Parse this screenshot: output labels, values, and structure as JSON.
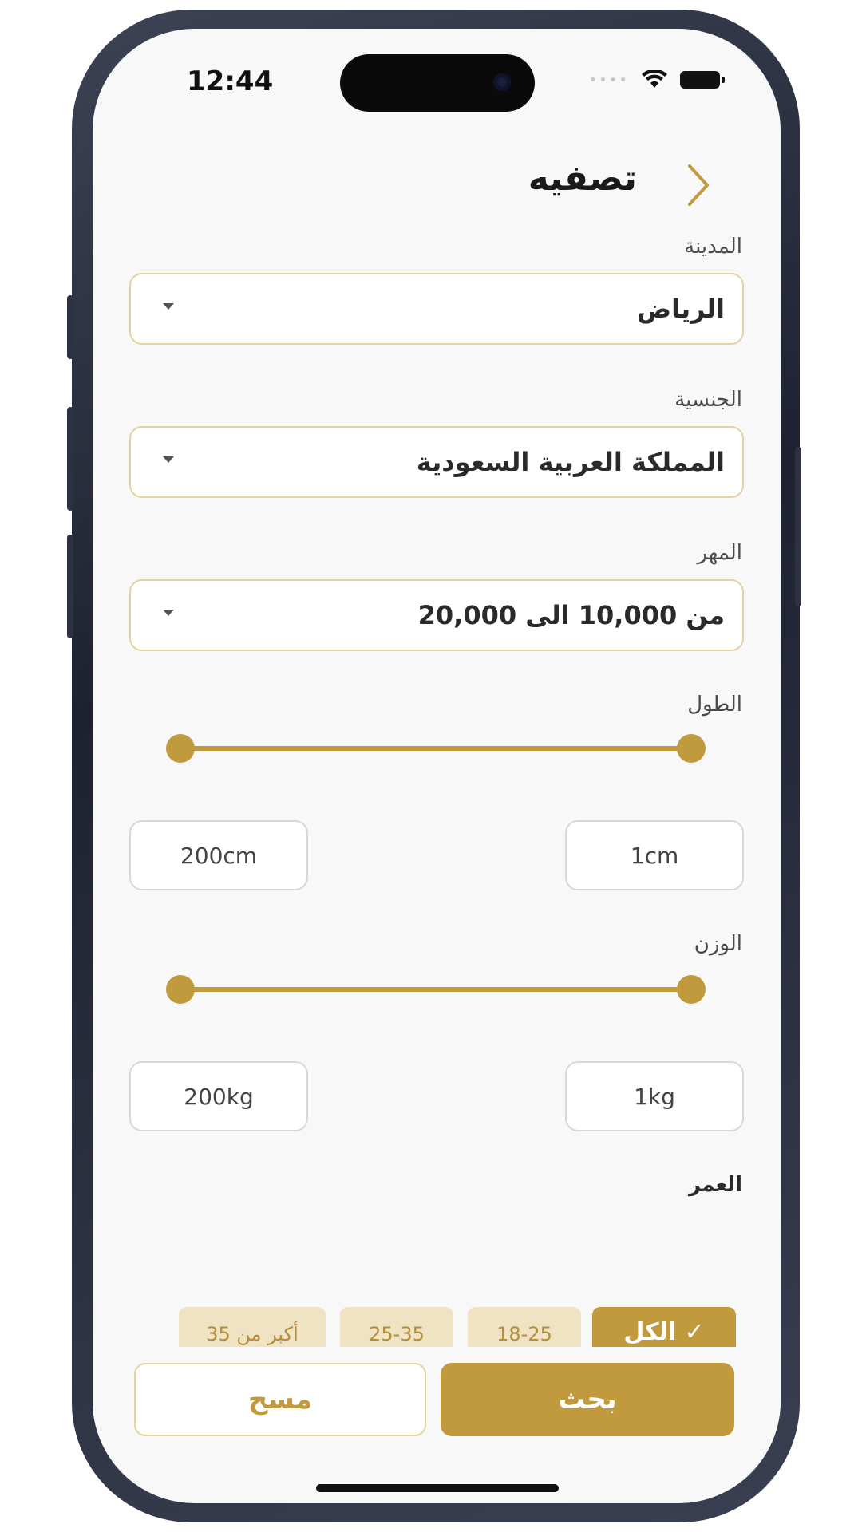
{
  "status": {
    "time": "12:44"
  },
  "header": {
    "title": "تصفيه"
  },
  "fields": {
    "city": {
      "label": "المدينة",
      "value": "الرياض"
    },
    "nationality": {
      "label": "الجنسية",
      "value": "المملكة العربية السعودية"
    },
    "dowry": {
      "label": "المهر",
      "value": "من 10,000 الى 20,000"
    }
  },
  "height": {
    "label": "الطول",
    "min": "1cm",
    "max": "200cm",
    "range_fraction": [
      0,
      1
    ]
  },
  "weight": {
    "label": "الوزن",
    "min": "1kg",
    "max": "200kg",
    "range_fraction": [
      0,
      1
    ]
  },
  "age": {
    "label": "العمر",
    "options": [
      "الكل",
      "18-25",
      "25-35",
      "أكبر من 35"
    ],
    "selected": "الكل",
    "check": "✓"
  },
  "actions": {
    "search": "بحث",
    "clear": "مسح"
  },
  "colors": {
    "accent": "#c09a3c",
    "accent_light": "#efe3c4",
    "border": "#e3d3a0"
  }
}
